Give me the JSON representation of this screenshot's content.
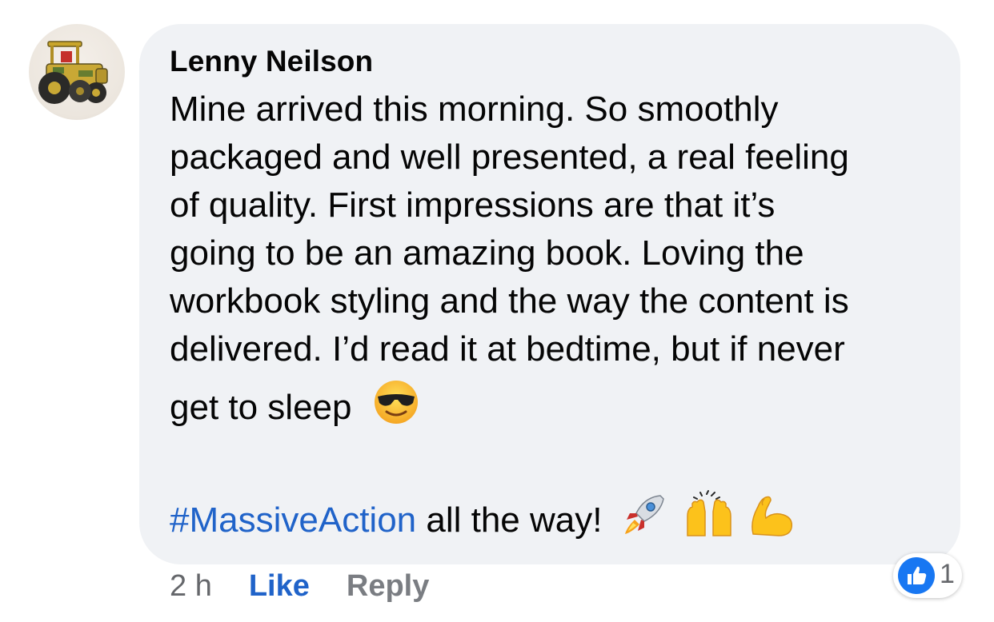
{
  "comment": {
    "author": "Lenny Neilson",
    "lines": [
      "Mine arrived this morning. So smoothly",
      "packaged and well presented, a real feeling",
      "of quality. First impressions are that it’s",
      "going to be an amazing book. Loving the",
      "workbook styling and the way the content is",
      "delivered. I’d read it at bedtime, but if never",
      "get to sleep"
    ],
    "hashtag": "#MassiveAction",
    "closing_text": " all the way!"
  },
  "actions": {
    "time": "2 h",
    "like_label": "Like",
    "reply_label": "Reply"
  },
  "reactions": {
    "icon": "thumbs-up-icon",
    "count": "1"
  },
  "emojis": [
    "sunglasses-face-icon",
    "rocket-icon",
    "raising-hands-icon",
    "flexed-biceps-icon"
  ],
  "colors": {
    "bubble": "#f0f2f5",
    "hashtag": "#2063c9",
    "like": "#2063c9",
    "meta_text": "#65676b",
    "reaction_blue": "#1877f2"
  }
}
